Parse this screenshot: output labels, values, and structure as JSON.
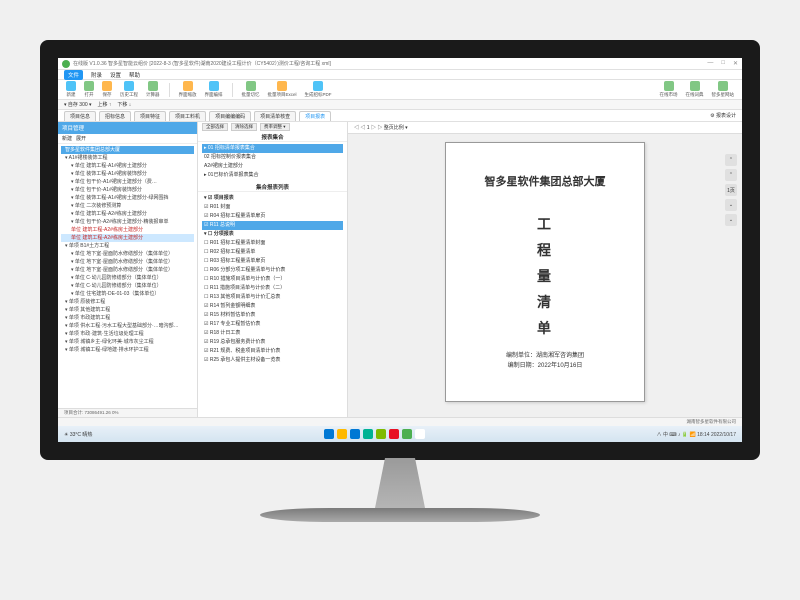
{
  "window": {
    "title": "在线版 V1.0.36 智多星智能云组价 [2022-8-3 (智多星软件)湖南2020建设工程计价（CY5402）)测价工程/咨询工程 xml]",
    "min": "—",
    "max": "□",
    "close": "✕"
  },
  "menu": [
    "文件",
    "附录",
    "设置",
    "帮助"
  ],
  "toolbar": {
    "items": [
      "新建",
      "打开",
      "保存",
      "历史工程",
      "计算器",
      "界面缩放",
      "界面编排",
      "批量切忆",
      "批量项目Excel",
      "生成招标PDF"
    ],
    "right": [
      "在线市场",
      "在线词典",
      "智多星网站"
    ]
  },
  "rowbar": {
    "a": "▾ 自存 300 ▾",
    "b": "上移 ↑",
    "c": "下移 ↓"
  },
  "tabs": {
    "items": [
      "项目信息",
      "招标信息",
      "项目特征",
      "项目工料机",
      "项目编编编码",
      "项目清单核查",
      "项目报表"
    ],
    "right": [
      "报表设计"
    ]
  },
  "left": {
    "head": "项目管理",
    "subtabs": [
      "新建",
      "展开"
    ],
    "nodes": [
      {
        "t": "智多星软件集团总部大厦",
        "cls": "hl d1"
      },
      {
        "t": "▾ A1#裙楼装饰工程",
        "cls": "d1"
      },
      {
        "t": "▾ 单位   建筑工程-A1#裙房土建部分",
        "cls": "d2"
      },
      {
        "t": "▾ 单位   装饰工程-A1#裙房装饰部分",
        "cls": "d2"
      },
      {
        "t": "▾ 单位   包干价-A1#裙房土建部分（费…",
        "cls": "d2"
      },
      {
        "t": "▾ 单位   包干价-A1#裙房装饰部分",
        "cls": "d2"
      },
      {
        "t": "▾ 单位   装饰工程-A1#裙房土建部分-绿网围挡",
        "cls": "d2"
      },
      {
        "t": "▾ 单位   二次装修预测算",
        "cls": "d2"
      },
      {
        "t": "▾ 单位   建筑工程-A2#栋房土建部分",
        "cls": "d2"
      },
      {
        "t": "▾ 单位   包干价-A2#栋房土建部分-精装报审单",
        "cls": "d2"
      },
      {
        "t": "单位   建筑工程-A2#栋房土建部分",
        "cls": "d2 red"
      },
      {
        "t": "单位   建筑工程-A2#栋房土建部分",
        "cls": "d2 sel red"
      },
      {
        "t": "▾ 单项   B1#土方工程",
        "cls": "d1"
      },
      {
        "t": "▾ 单位   地下室·屋面防水修缮部分（集体单位）",
        "cls": "d2"
      },
      {
        "t": "▾ 单位   地下室·屋面防水修缮部分（集体单位）",
        "cls": "d2"
      },
      {
        "t": "▾ 单位   地下室·屋面防水修缮部分（集体单位）",
        "cls": "d2"
      },
      {
        "t": "▾ 单位   C·幼儿园防修缮部分（集体单位）",
        "cls": "d2"
      },
      {
        "t": "▾ 单位   C·幼儿园防修缮部分（集体单位）",
        "cls": "d2"
      },
      {
        "t": "▾ 单位   住宅建筑-DE-01-03（集体单位）",
        "cls": "d2"
      },
      {
        "t": "▾ 单项   原装修工程",
        "cls": "d1"
      },
      {
        "t": "▾ 单项   其他建筑工程",
        "cls": "d1"
      },
      {
        "t": "▾ 单项   市政建筑工程",
        "cls": "d1"
      },
      {
        "t": "▾ 单项   供水工程·污水工程大型基础部分·…暗沟部…",
        "cls": "d1"
      },
      {
        "t": "▾ 单项   市政·建筑·生活垃圾处理工程",
        "cls": "d1"
      },
      {
        "t": "▾ 单项   城镇乡主-绿化环美·城市灰尘工程",
        "cls": "d1"
      },
      {
        "t": "▾ 单项   城镇工程-绿地建·排水环护工程",
        "cls": "d1"
      }
    ],
    "status": "项目合计: 73086491.26    0%"
  },
  "mid": {
    "btns": [
      "全部选择",
      "清除选择",
      "费率调整 ▾"
    ],
    "sect1": "报表集合",
    "list1": [
      {
        "t": "▸ 01 招标清单报表集合",
        "sel": true
      },
      {
        "t": "02 招标控制价报表集合"
      },
      {
        "t": "A2#裙房土建部分"
      },
      {
        "t": "▸ 01已标价清单报表集合"
      }
    ],
    "sect2": "集合报表列表",
    "list2": [
      {
        "t": "▾ ☑ 项目报表",
        "b": true
      },
      {
        "t": "☑ R01 封面"
      },
      {
        "t": "☑ R04 招标工程量清单扉页"
      },
      {
        "t": "☑ R11 总说明",
        "sel": true
      },
      {
        "t": "▾ ☐ 分项报表",
        "b": true
      },
      {
        "t": "☐ R01 招标工程量清单封面"
      },
      {
        "t": "☐ R02 招标工程量清单"
      },
      {
        "t": "☐ R03 招标工程量清单扉页"
      },
      {
        "t": "☐ R06 分部分项工程量清单与计价表"
      },
      {
        "t": "☐ R10 措施项目清单与计价表（一）"
      },
      {
        "t": "☐ R11 措施项目清单与计价表（二）"
      },
      {
        "t": "☐ R13 其他项目清单与计价汇总表"
      },
      {
        "t": "☑ R14 暂列金额明细表"
      },
      {
        "t": "☑ R15 材料暂估单价表"
      },
      {
        "t": "☑ R17 专业工程暂估价表"
      },
      {
        "t": "☑ R18 计日工表"
      },
      {
        "t": "☑ R19 总承包服务费计价表"
      },
      {
        "t": "☑ R21 规费、税金项目清单计价表"
      },
      {
        "t": "☑ R25 承包人提供主材设备一览表"
      }
    ]
  },
  "preview": {
    "nav": "◁ ◁ 1 ▷ ▷ 整页比例 ▾",
    "doc_title": "智多星软件集团总部大厦",
    "doc_vert": [
      "工",
      "程",
      "量",
      "清",
      "单"
    ],
    "foot1": "编制单位：湖南湘军咨询集团",
    "foot2": "编制日期：2022年10月16日",
    "side": [
      "⌃",
      "⌃",
      "1页",
      "⌄",
      "⌄"
    ]
  },
  "status_right": "湖南智多星软件有限公司",
  "taskbar": {
    "weather": "☀ 33°C  晴热",
    "icons": [
      "#0078d4",
      "#ffb900",
      "#0078d4",
      "#00b294",
      "#7fba00",
      "#e81123",
      "#4caf50",
      "#fff"
    ],
    "tray": "∧ 中 ⌨ ♪ 🔋 📶 18:14 2022/10/17"
  }
}
